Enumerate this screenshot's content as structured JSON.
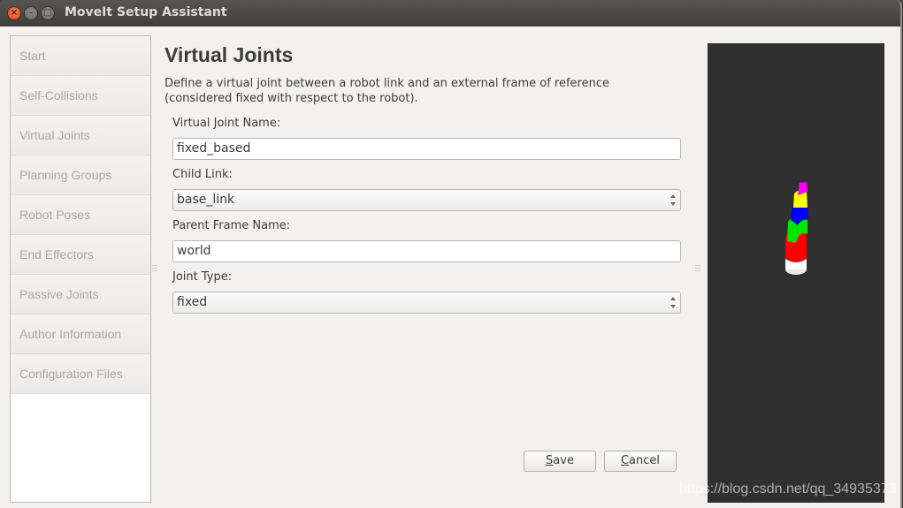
{
  "window": {
    "title": "MoveIt Setup Assistant",
    "controls": {
      "close": "×",
      "minimize": "–",
      "maximize": "□"
    }
  },
  "sidebar": {
    "items": [
      {
        "label": "Start"
      },
      {
        "label": "Self-Collisions"
      },
      {
        "label": "Virtual Joints"
      },
      {
        "label": "Planning Groups"
      },
      {
        "label": "Robot Poses"
      },
      {
        "label": "End Effectors"
      },
      {
        "label": "Passive Joints"
      },
      {
        "label": "Author Information"
      },
      {
        "label": "Configuration Files"
      }
    ]
  },
  "main": {
    "title": "Virtual Joints",
    "description": "Define a virtual joint between a robot link and an external frame of reference (considered fixed with respect to the robot).",
    "form": {
      "virtual_joint_name": {
        "label": "Virtual Joint Name:",
        "value": "fixed_based"
      },
      "child_link": {
        "label": "Child Link:",
        "value": "base_link"
      },
      "parent_frame_name": {
        "label": "Parent Frame Name:",
        "value": "world"
      },
      "joint_type": {
        "label": "Joint Type:",
        "value": "fixed"
      }
    },
    "buttons": {
      "save": {
        "mnemonic": "S",
        "rest": "ave"
      },
      "cancel": {
        "mnemonic": "C",
        "rest": "ancel"
      }
    }
  },
  "viewer": {
    "background": "#303030",
    "robot_segment_colors": [
      "#ffffff",
      "#ff0000",
      "#00ff00",
      "#0000ff",
      "#ffff00",
      "#ff00ff"
    ]
  },
  "watermark": "https://blog.csdn.net/qq_34935373"
}
